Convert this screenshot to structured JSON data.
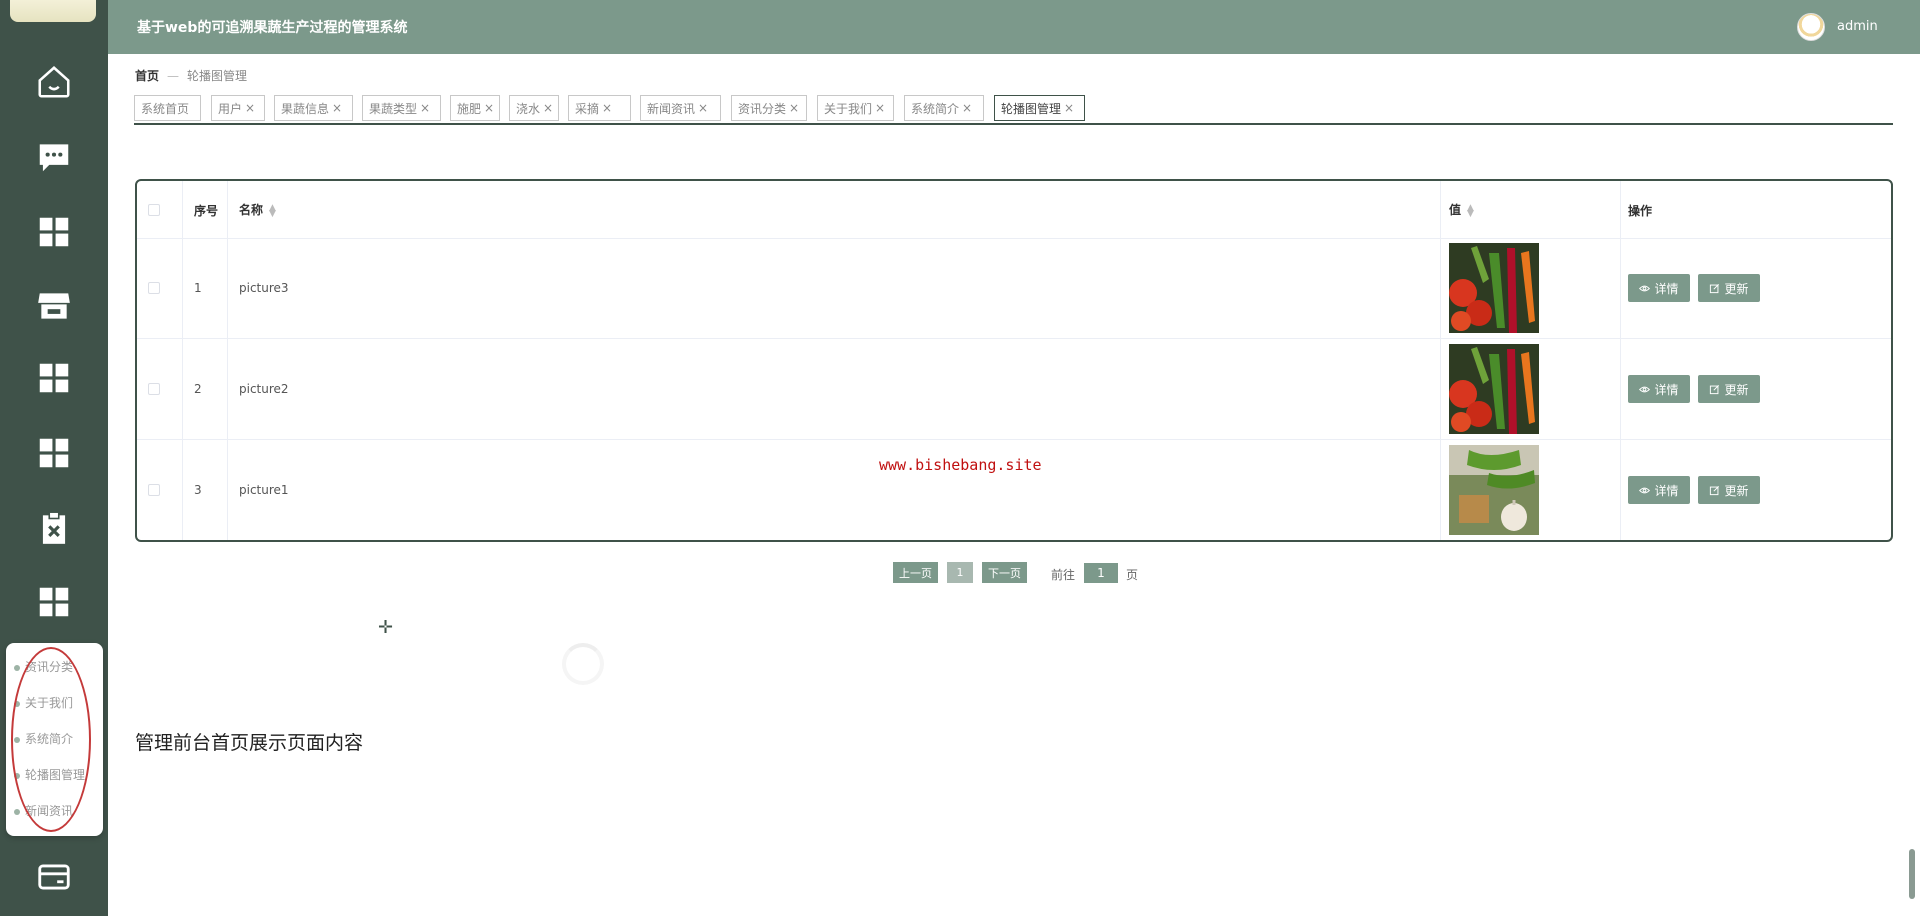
{
  "app": {
    "title": "基于web的可追溯果蔬生产过程的管理系统",
    "user": "admin"
  },
  "sidebar": {
    "icons": [
      "home-icon",
      "chat-icon",
      "grid-icon",
      "store-icon",
      "grid-icon",
      "grid-icon",
      "clipboard-x-icon",
      "grid-icon",
      "card-icon"
    ],
    "submenu": [
      "资讯分类",
      "关于我们",
      "系统简介",
      "轮播图管理",
      "新闻资讯"
    ]
  },
  "breadcrumb": {
    "home": "首页",
    "current": "轮播图管理"
  },
  "tabs": [
    {
      "label": "系统首页",
      "closable": false
    },
    {
      "label": "用户",
      "closable": true
    },
    {
      "label": "果蔬信息",
      "closable": true
    },
    {
      "label": "果蔬类型",
      "closable": true
    },
    {
      "label": "施肥",
      "closable": true
    },
    {
      "label": "浇水",
      "closable": true
    },
    {
      "label": "采摘",
      "closable": true
    },
    {
      "label": "新闻资讯",
      "closable": true
    },
    {
      "label": "资讯分类",
      "closable": true
    },
    {
      "label": "关于我们",
      "closable": true
    },
    {
      "label": "系统简介",
      "closable": true
    },
    {
      "label": "轮播图管理",
      "closable": true,
      "active": true
    }
  ],
  "tab_close_glyph": "×",
  "table": {
    "headers": {
      "index": "序号",
      "name": "名称",
      "value": "值",
      "action": "操作"
    },
    "rows": [
      {
        "index": "1",
        "name": "picture3",
        "image": "vegetables-tomato-carrot"
      },
      {
        "index": "2",
        "name": "picture2",
        "image": "vegetables-tomato-carrot"
      },
      {
        "index": "3",
        "name": "picture1",
        "image": "vegetables-cucumber-garlic"
      }
    ],
    "detail_label": "详情",
    "update_label": "更新"
  },
  "watermark": "www.bishebang.site",
  "pagination": {
    "prev": "上一页",
    "current": "1",
    "next": "下一页",
    "goto_prefix": "前往",
    "goto_value": "1",
    "goto_suffix": "页"
  },
  "front_page_text": "管理前台首页展示页面内容",
  "colors": {
    "sidebar": "#3f5249",
    "header": "#7c998b",
    "accent": "#7c998b",
    "annotation": "#c43a3a"
  }
}
